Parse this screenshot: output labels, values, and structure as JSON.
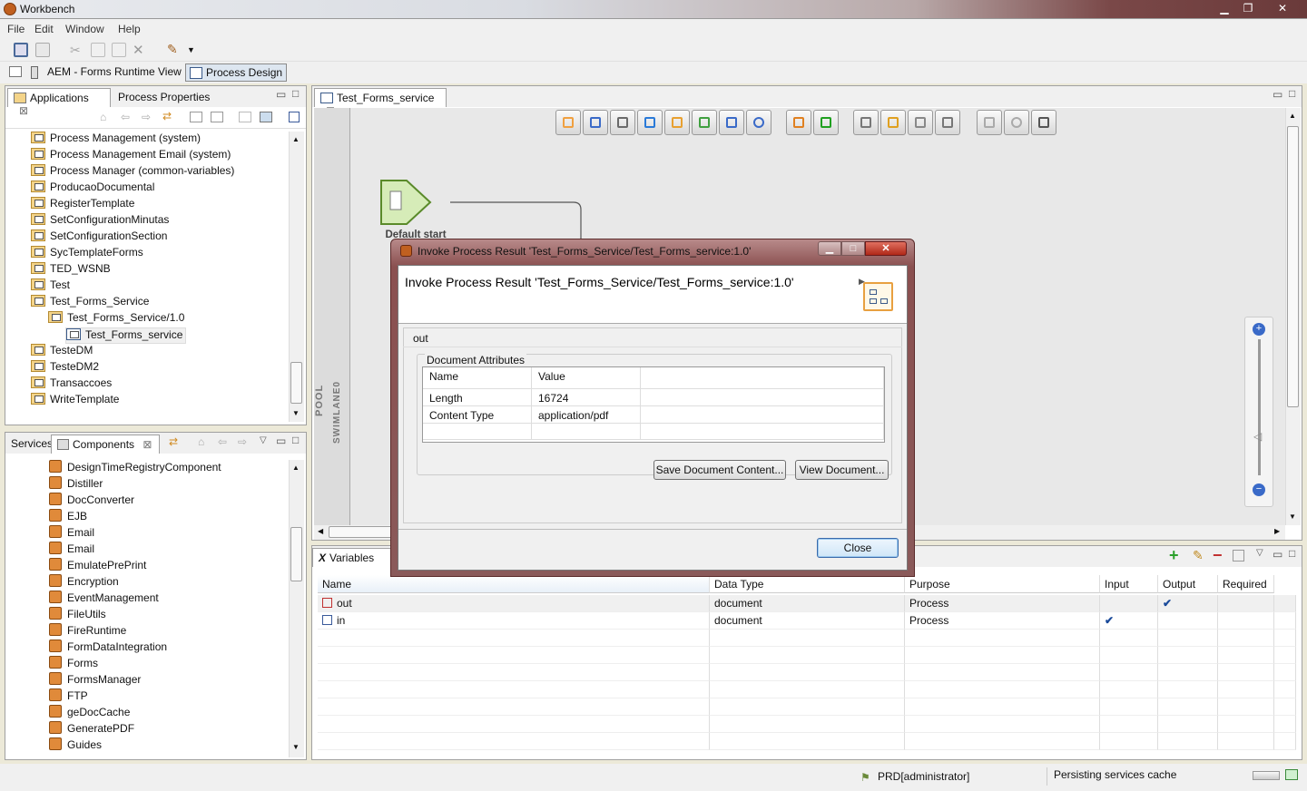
{
  "window": {
    "title": "Workbench"
  },
  "menu": [
    "File",
    "Edit",
    "Window",
    "Help"
  ],
  "perspectives": {
    "runtime": "AEM - Forms Runtime View",
    "design": "Process Design"
  },
  "left_top": {
    "tabs": [
      "Applications",
      "Process Properties"
    ],
    "tree": [
      {
        "label": "Process Management (system)",
        "indent": 0,
        "type": "folder"
      },
      {
        "label": "Process Management Email (system)",
        "indent": 0,
        "type": "folder"
      },
      {
        "label": "Process Manager (common-variables)",
        "indent": 0,
        "type": "folder"
      },
      {
        "label": "ProducaoDocumental",
        "indent": 0,
        "type": "folder"
      },
      {
        "label": "RegisterTemplate",
        "indent": 0,
        "type": "folder"
      },
      {
        "label": "SetConfigurationMinutas",
        "indent": 0,
        "type": "folder"
      },
      {
        "label": "SetConfigurationSection",
        "indent": 0,
        "type": "folder"
      },
      {
        "label": "SycTemplateForms",
        "indent": 0,
        "type": "folder"
      },
      {
        "label": "TED_WSNB",
        "indent": 0,
        "type": "folder"
      },
      {
        "label": "Test",
        "indent": 0,
        "type": "folder"
      },
      {
        "label": "Test_Forms_Service",
        "indent": 0,
        "type": "folder"
      },
      {
        "label": "Test_Forms_Service/1.0",
        "indent": 1,
        "type": "version"
      },
      {
        "label": "Test_Forms_service",
        "indent": 2,
        "type": "process"
      },
      {
        "label": "TesteDM",
        "indent": 0,
        "type": "folder"
      },
      {
        "label": "TesteDM2",
        "indent": 0,
        "type": "folder"
      },
      {
        "label": "Transaccoes",
        "indent": 0,
        "type": "folder"
      },
      {
        "label": "WriteTemplate",
        "indent": 0,
        "type": "folder"
      }
    ]
  },
  "left_bottom": {
    "tabs": [
      "Services",
      "Components"
    ],
    "items": [
      "DesignTimeRegistryComponent",
      "Distiller",
      "DocConverter",
      "EJB",
      "Email",
      "Email",
      "EmulatePrePrint",
      "Encryption",
      "EventManagement",
      "FileUtils",
      "FireRuntime",
      "FormDataIntegration",
      "Forms",
      "FormsManager",
      "FTP",
      "geDocCache",
      "GeneratePDF",
      "Guides"
    ]
  },
  "editor": {
    "tab": "Test_Forms_service",
    "start_label": "Default start point",
    "pool": "POOL",
    "swimlane": "SWIMLANE0"
  },
  "variables": {
    "tab": "Variables",
    "headers": [
      "Name",
      "Data Type",
      "Purpose",
      "Input",
      "Output",
      "Required"
    ],
    "rows": [
      {
        "name": "out",
        "type": "document",
        "purpose": "Process",
        "input": "",
        "output": "✔"
      },
      {
        "name": "in",
        "type": "document",
        "purpose": "Process",
        "input": "✔",
        "output": ""
      }
    ]
  },
  "dialog": {
    "title": "Invoke Process Result 'Test_Forms_Service/Test_Forms_service:1.0'",
    "heading": "Invoke Process Result 'Test_Forms_Service/Test_Forms_service:1.0'",
    "section": "out",
    "group": "Document Attributes",
    "table_headers": [
      "Name",
      "Value"
    ],
    "table_rows": [
      [
        "Length",
        "16724"
      ],
      [
        "Content Type",
        "application/pdf"
      ]
    ],
    "save_btn": "Save Document Content...",
    "view_btn": "View Document...",
    "close_btn": "Close"
  },
  "status": {
    "user": "PRD[administrator]",
    "message": "Persisting services cache"
  }
}
